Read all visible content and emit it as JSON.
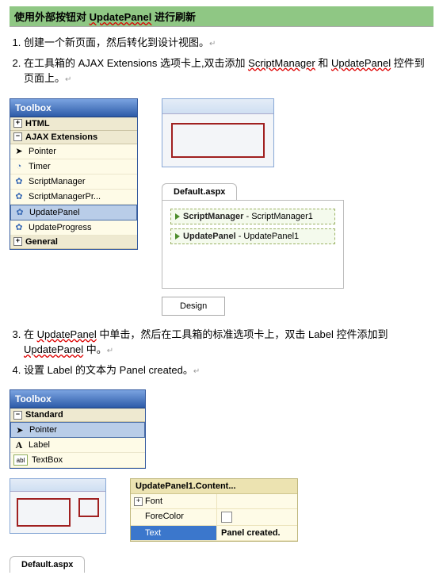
{
  "heading": {
    "pre": "使用外部按钮对 ",
    "wave": "UpdatePanel",
    "post": "进行刷新"
  },
  "steps": {
    "s1": "创建一个新页面，然后转化到设计视图。",
    "s2_a": "在工具箱的 AJAX Extensions 选项卡上,双击添加 ",
    "s2_w1": "ScriptManager",
    "s2_b": " 和 ",
    "s2_w2": "UpdatePanel",
    "s2_c": " 控件到页面上。",
    "s3_a": "在 ",
    "s3_w1": "UpdatePanel",
    "s3_b": " 中单击，然后在工具箱的标准选项卡上，双击 Label 控件添加到 ",
    "s3_w2": "UpdatePanel",
    "s3_c": " 中。",
    "s4": "设置 Label 的文本为 Panel created。"
  },
  "toolbox1": {
    "title": "Toolbox",
    "groups": {
      "html": "HTML",
      "ajax": "AJAX Extensions",
      "general": "General"
    },
    "items": {
      "pointer": "Pointer",
      "timer": "Timer",
      "sm": "ScriptManager",
      "smp": "ScriptManagerPr...",
      "up": "UpdatePanel",
      "upp": "UpdateProgress"
    }
  },
  "defpanel1": {
    "tab": "Default.aspx",
    "row1_b": "ScriptManager",
    "row1_t": " - ScriptManager1",
    "row2_b": "UpdatePanel",
    "row2_t": " - UpdatePanel1",
    "design": "Design"
  },
  "toolbox2": {
    "title": "Toolbox",
    "group": "Standard",
    "items": {
      "pointer": "Pointer",
      "label": "Label",
      "textbox": "TextBox"
    }
  },
  "props": {
    "title": "UpdatePanel1.Content...",
    "font": "Font",
    "forecolor": "ForeColor",
    "text": "Text",
    "text_val": "Panel created."
  },
  "defbottom": {
    "tab": "Default.aspx"
  }
}
